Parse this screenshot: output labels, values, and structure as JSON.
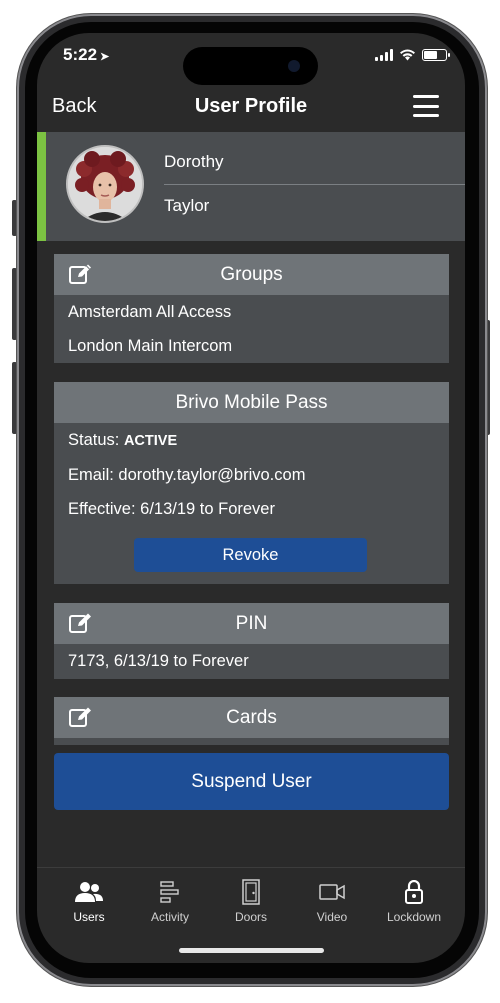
{
  "status_bar": {
    "time": "5:22"
  },
  "nav": {
    "back": "Back",
    "title": "User Profile"
  },
  "profile": {
    "first_name": "Dorothy",
    "last_name": "Taylor"
  },
  "groups": {
    "title": "Groups",
    "items": [
      "Amsterdam All Access",
      "London Main Intercom"
    ]
  },
  "mobile_pass": {
    "title": "Brivo Mobile Pass",
    "status_label": "Status: ",
    "status_value": "ACTIVE",
    "email": "Email: dorothy.taylor@brivo.com",
    "effective": "Effective: 6/13/19 to Forever",
    "revoke_label": "Revoke"
  },
  "pin": {
    "title": "PIN",
    "value": "7173, 6/13/19 to Forever"
  },
  "cards": {
    "title": "Cards"
  },
  "suspend_label": "Suspend User",
  "tabs": [
    {
      "label": "Users",
      "icon": "users-icon"
    },
    {
      "label": "Activity",
      "icon": "activity-icon"
    },
    {
      "label": "Doors",
      "icon": "door-icon"
    },
    {
      "label": "Video",
      "icon": "video-icon"
    },
    {
      "label": "Lockdown",
      "icon": "lock-icon"
    }
  ],
  "colors": {
    "accent_green": "#7cc242",
    "button_blue": "#1e4e96",
    "panel": "#4a4d50",
    "panel_header": "#6f7478",
    "background": "#2a2a2a"
  }
}
